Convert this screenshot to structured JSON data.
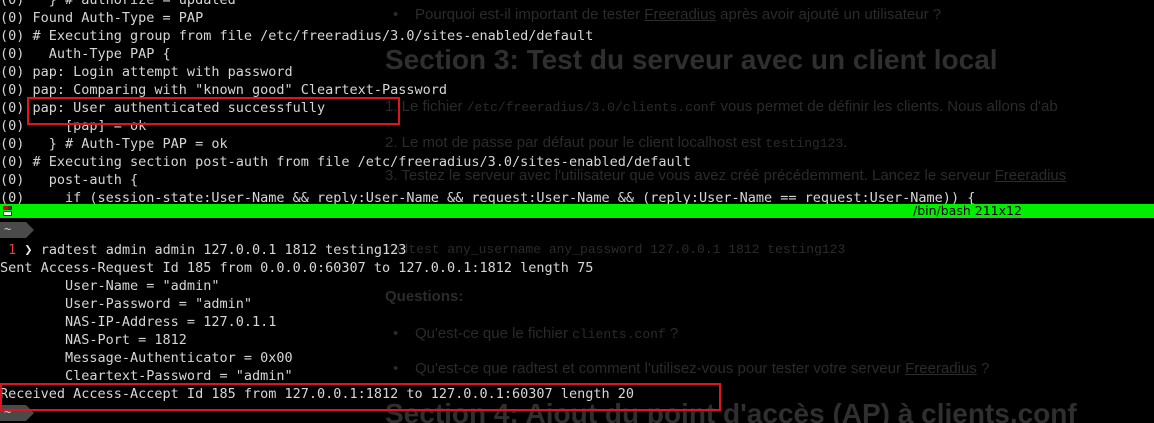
{
  "background_document": {
    "bullet_question_top": "Pourquoi est-il important de tester ",
    "bullet_question_top_link": "Freeradius",
    "bullet_question_top_tail": " après avoir ajouté un utilisateur ?",
    "section3_heading": "Section 3: Test du serveur avec un client local",
    "step1_prefix": "1. Le fichier ",
    "step1_code": "/etc/freeradius/3.0/clients.conf",
    "step1_tail": " vous permet de définir les clients. Nous allons d'ab",
    "step2_prefix": "2. Le mot de passe par défaut pour le client localhost est ",
    "step2_code": "testing123",
    "step2_tail": ".",
    "step3_prefix": "3. Testez le serveur avec l'utilisateur que vous avez créé précédemment. Lancez le serveur ",
    "step3_link": "Freeradius",
    "command_example": "radtest any_username any_password 127.0.0.1 1812 testing123",
    "questions_label": "Questions:",
    "question1_prefix": "Qu'est-ce que le fichier ",
    "question1_code": "clients.conf",
    "question1_tail": " ?",
    "question2_prefix": "Qu'est-ce que radtest et comment l'utilisez-vous pour tester votre serveur ",
    "question2_link": "Freeradius",
    "question2_tail": " ?",
    "section4_heading": "Section 4: Ajout du point d'accès (AP) à clients.conf"
  },
  "terminal_top": {
    "lines": [
      "(0)   } # authorize = updated",
      "(0) Found Auth-Type = PAP",
      "(0) # Executing group from file /etc/freeradius/3.0/sites-enabled/default",
      "(0)   Auth-Type PAP {",
      "(0) pap: Login attempt with password",
      "(0) pap: Comparing with \"known good\" Cleartext-Password",
      "(0) pap: User authenticated successfully",
      "(0)     [pap] = ok",
      "(0)   } # Auth-Type PAP = ok",
      "(0) # Executing section post-auth from file /etc/freeradius/3.0/sites-enabled/default",
      "(0)   post-auth {",
      "(0)     if (session-state:User-Name && reply:User-Name && request:User-Name && (reply:User-Name == request:User-Name)) {"
    ]
  },
  "status_bar": {
    "shell_info": "/bin/bash 211x12",
    "color": "#00ee00"
  },
  "terminal_bottom": {
    "prompt_home": "~",
    "prompt_exit_code": "1",
    "prompt_arrow": "❯",
    "command": " radtest admin admin 127.0.0.1 1812 testing123",
    "output_lines": [
      "Sent Access-Request Id 185 from 0.0.0.0:60307 to 127.0.0.1:1812 length 75",
      "        User-Name = \"admin\"",
      "        User-Password = \"admin\"",
      "        NAS-IP-Address = 127.0.1.1",
      "        NAS-Port = 1812",
      "        Message-Authenticator = 0x00",
      "        Cleartext-Password = \"admin\"",
      "Received Access-Accept Id 185 from 127.0.0.1:1812 to 127.0.0.1:60307 length 20"
    ],
    "prompt_home_2": "~",
    "prompt_partial": "❯"
  },
  "colors": {
    "highlight_border": "#e0141e",
    "terminal_text": "#d6d6d6",
    "prompt_exit_code": "#e04040"
  }
}
